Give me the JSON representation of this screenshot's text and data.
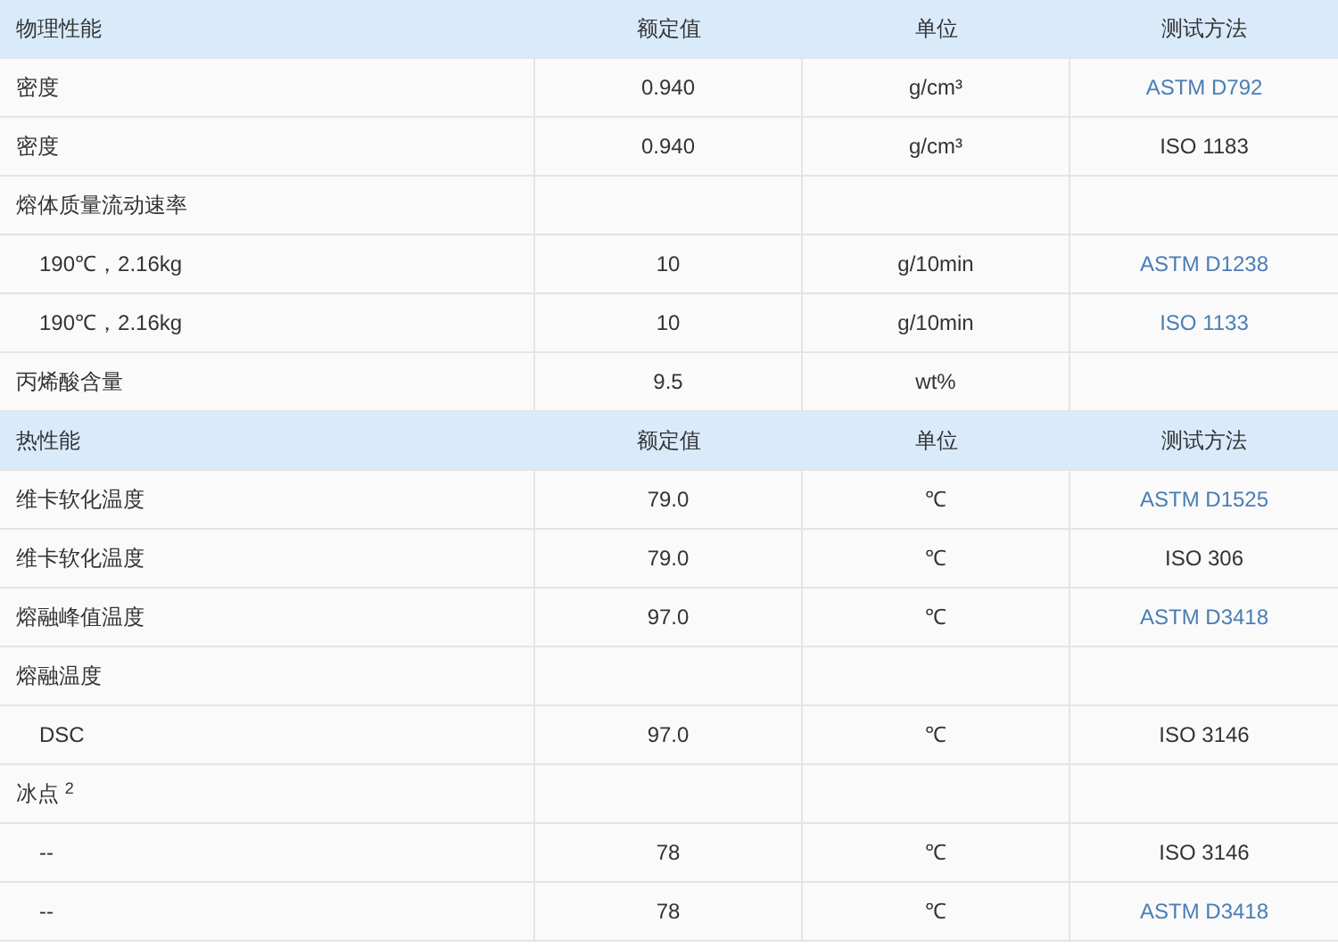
{
  "sections": [
    {
      "header": [
        "物理性能",
        "额定值",
        "单位",
        "测试方法"
      ],
      "rows": [
        {
          "property": "密度",
          "indented": false,
          "value": "0.940",
          "unit": "g/cm³",
          "method": "ASTM D792",
          "method_link": true
        },
        {
          "property": "密度",
          "indented": false,
          "value": "0.940",
          "unit": "g/cm³",
          "method": "ISO 1183",
          "method_link": false
        },
        {
          "property": "熔体质量流动速率",
          "indented": false
        },
        {
          "property": "190℃，2.16kg",
          "indented": true,
          "value": "10",
          "unit": "g/10min",
          "method": "ASTM D1238",
          "method_link": true
        },
        {
          "property": "190℃，2.16kg",
          "indented": true,
          "value": "10",
          "unit": "g/10min",
          "method": "ISO 1133",
          "method_link": true
        },
        {
          "property": "丙烯酸含量",
          "indented": false,
          "value": "9.5",
          "unit": "wt%"
        }
      ]
    },
    {
      "header": [
        "热性能",
        "额定值",
        "单位",
        "测试方法"
      ],
      "rows": [
        {
          "property": "维卡软化温度",
          "indented": false,
          "value": "79.0",
          "unit": "℃",
          "method": "ASTM D1525",
          "method_link": true
        },
        {
          "property": "维卡软化温度",
          "indented": false,
          "value": "79.0",
          "unit": "℃",
          "method": "ISO 306",
          "method_link": false
        },
        {
          "property": "熔融峰值温度",
          "indented": false,
          "value": "97.0",
          "unit": "℃",
          "method": "ASTM D3418",
          "method_link": true
        },
        {
          "property": "熔融温度",
          "indented": false
        },
        {
          "property": "DSC",
          "indented": true,
          "value": "97.0",
          "unit": "℃",
          "method": "ISO 3146",
          "method_link": false
        },
        {
          "property": "冰点 $^{2}$",
          "indented": false
        },
        {
          "property": "--",
          "indented": true,
          "value": "78",
          "unit": "℃",
          "method": "ISO 3146",
          "method_link": false
        },
        {
          "property": "--",
          "indented": true,
          "value": "78",
          "unit": "℃",
          "method": "ASTM D3418",
          "method_link": true
        }
      ]
    }
  ]
}
